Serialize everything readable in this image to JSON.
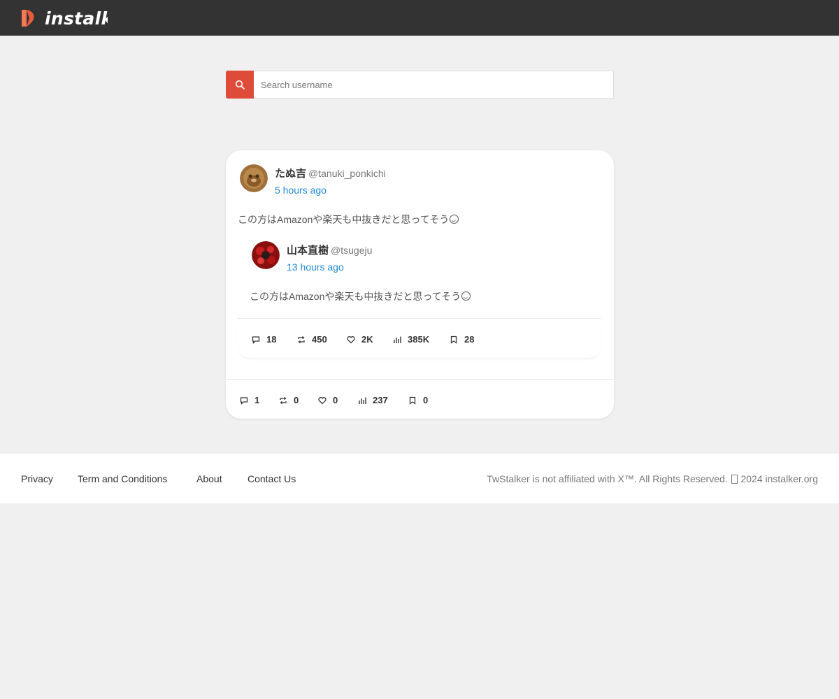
{
  "brand": {
    "name": "instalker",
    "accent": "#de4b39",
    "link_color": "#1e8ad6",
    "header_bg": "#333333"
  },
  "search": {
    "placeholder": "Search username",
    "icon": "search-icon"
  },
  "post": {
    "author_name": "たぬ吉",
    "author_handle": "@tanuki_ponkichi",
    "time": "5 hours ago",
    "text": "この方はAmazonや楽天も中抜きだと思ってそう",
    "quoted": {
      "author_name": "山本直樹",
      "author_handle": "@tsugeju",
      "time": "13 hours ago",
      "text": "この方はAmazonや楽天も中抜きだと思ってそう",
      "stats": {
        "replies": "18",
        "retweets": "450",
        "likes": "2K",
        "views": "385K",
        "bookmarks": "28"
      }
    },
    "stats": {
      "replies": "1",
      "retweets": "0",
      "likes": "0",
      "views": "237",
      "bookmarks": "0"
    }
  },
  "footer": {
    "links": [
      "Privacy",
      "Term and Conditions",
      "About",
      "Contact Us"
    ],
    "copyright_prefix": "TwStalker is not affiliated with X™. All Rights Reserved.",
    "copyright_suffix": "2024 instalker.org"
  }
}
